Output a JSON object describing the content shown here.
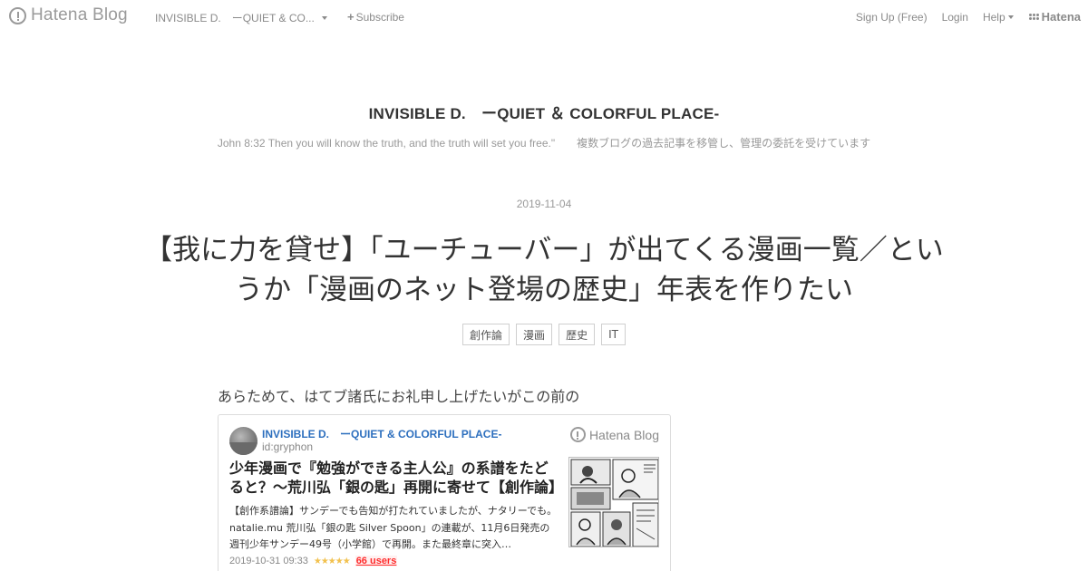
{
  "topbar": {
    "brand": "Hatena Blog",
    "blog_name": "INVISIBLE D.　ーQUIET & CO...",
    "subscribe": "Subscribe",
    "signup": "Sign Up (Free)",
    "login": "Login",
    "help": "Help",
    "hatena": "Hatena"
  },
  "header": {
    "title": "INVISIBLE D.　ーQUIET ＆ COLORFUL PLACE-",
    "description": "John 8:32 Then you will know the truth, and the truth will set you free.\"　　複数ブログの過去記事を移管し、管理の委託を受けています"
  },
  "entry": {
    "date": "2019-11-04",
    "title": "【我に力を貸せ】「ユーチューバー」が出てくる漫画一覧／というか「漫画のネット登場の歴史」年表を作りたい",
    "tags": [
      "創作論",
      "漫画",
      "歴史",
      "IT"
    ],
    "paragraph": "あらためて、はてブ諸氏にお礼申し上げたいがこの前の"
  },
  "embed_card": {
    "blog_name": "INVISIBLE D.　ーQUIET & COLORFUL PLACE-",
    "user_id": "id:gryphon",
    "brand": "Hatena Blog",
    "title": "少年漫画で『勉強ができる主人公』の系譜をたどると？〜荒川弘「銀の匙」再開に寄せて【創作論】",
    "excerpt": "【創作系譜論】サンデーでも告知が打たれていましたが、ナタリーでも。 natalie.mu 荒川弘「銀の匙 Silver Spoon」の連載が、11月6日発売の週刊少年サンデー49号（小学館）で再開。また最終章に突入…",
    "date": "2019-10-31 09:33",
    "stars": "★★★★★",
    "users": "66 users"
  },
  "colors": {
    "link_blue": "#2d6fbe",
    "bookmark_red": "#ff2b2b",
    "star_yellow": "#f2c14e"
  }
}
